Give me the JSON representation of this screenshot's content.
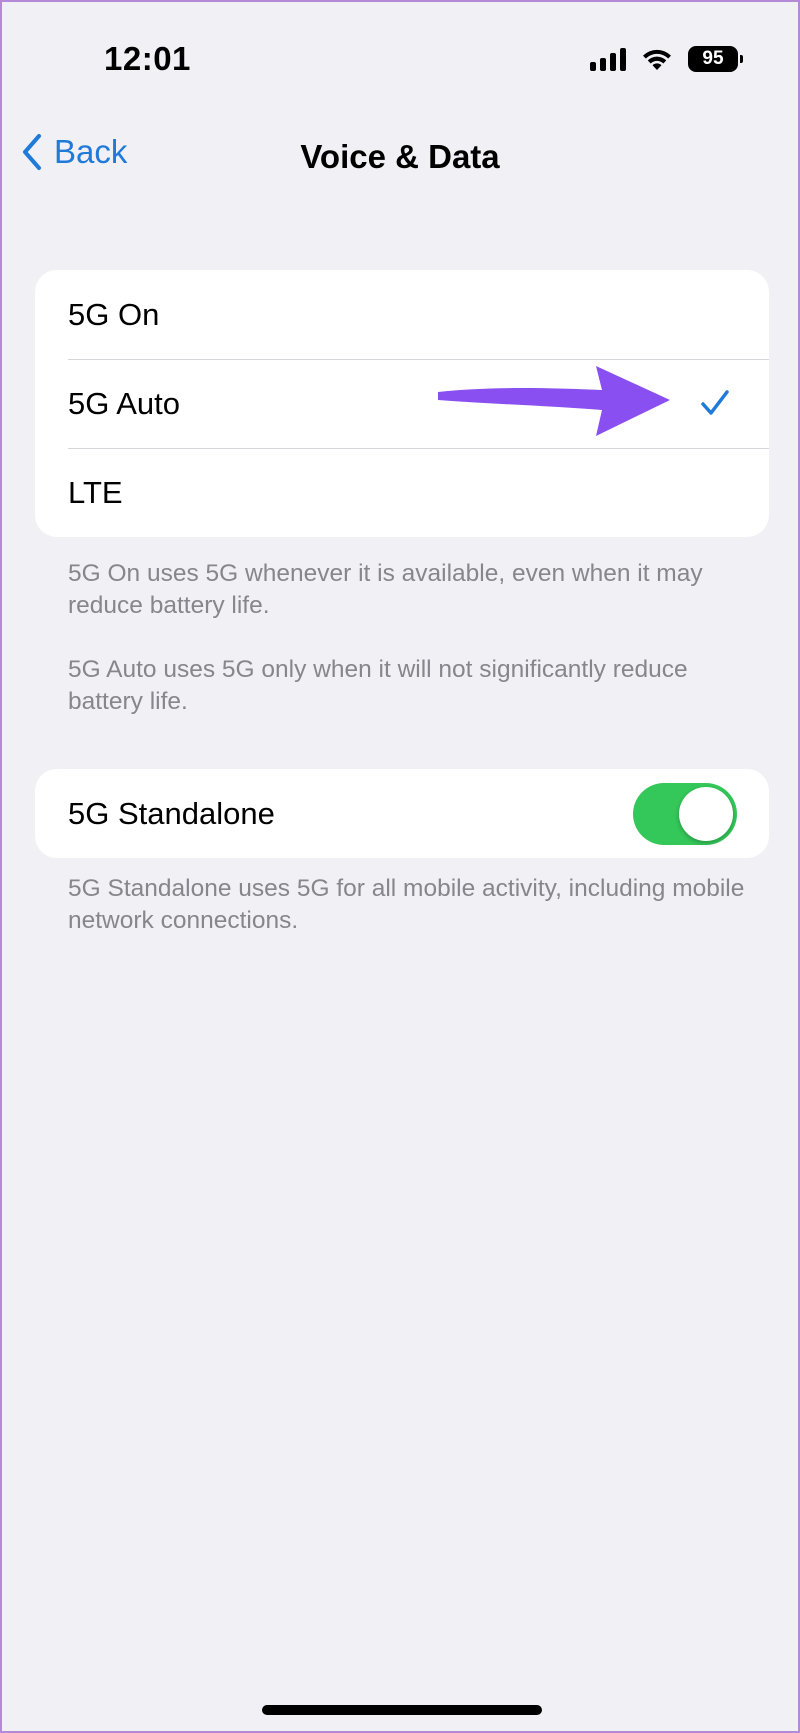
{
  "status_bar": {
    "time": "12:01",
    "battery_level": "95",
    "icons": [
      "cellular-signal-icon",
      "wifi-icon",
      "battery-icon"
    ]
  },
  "nav": {
    "back_label": "Back",
    "title": "Voice & Data"
  },
  "network_options": {
    "items": [
      {
        "label": "5G On",
        "selected": false
      },
      {
        "label": "5G Auto",
        "selected": true
      },
      {
        "label": "LTE",
        "selected": false
      }
    ],
    "footnote_1": "5G On uses 5G whenever it is available, even when it may reduce battery life.",
    "footnote_2": "5G Auto uses 5G only when it will not significantly reduce battery life."
  },
  "standalone": {
    "label": "5G Standalone",
    "enabled": true,
    "footnote": "5G Standalone uses 5G for all mobile activity, including mobile network connections."
  },
  "colors": {
    "background": "#f0f0f5",
    "accent_blue": "#1f7ad8",
    "toggle_on": "#34c759",
    "annotation_arrow": "#8a4ff0"
  }
}
